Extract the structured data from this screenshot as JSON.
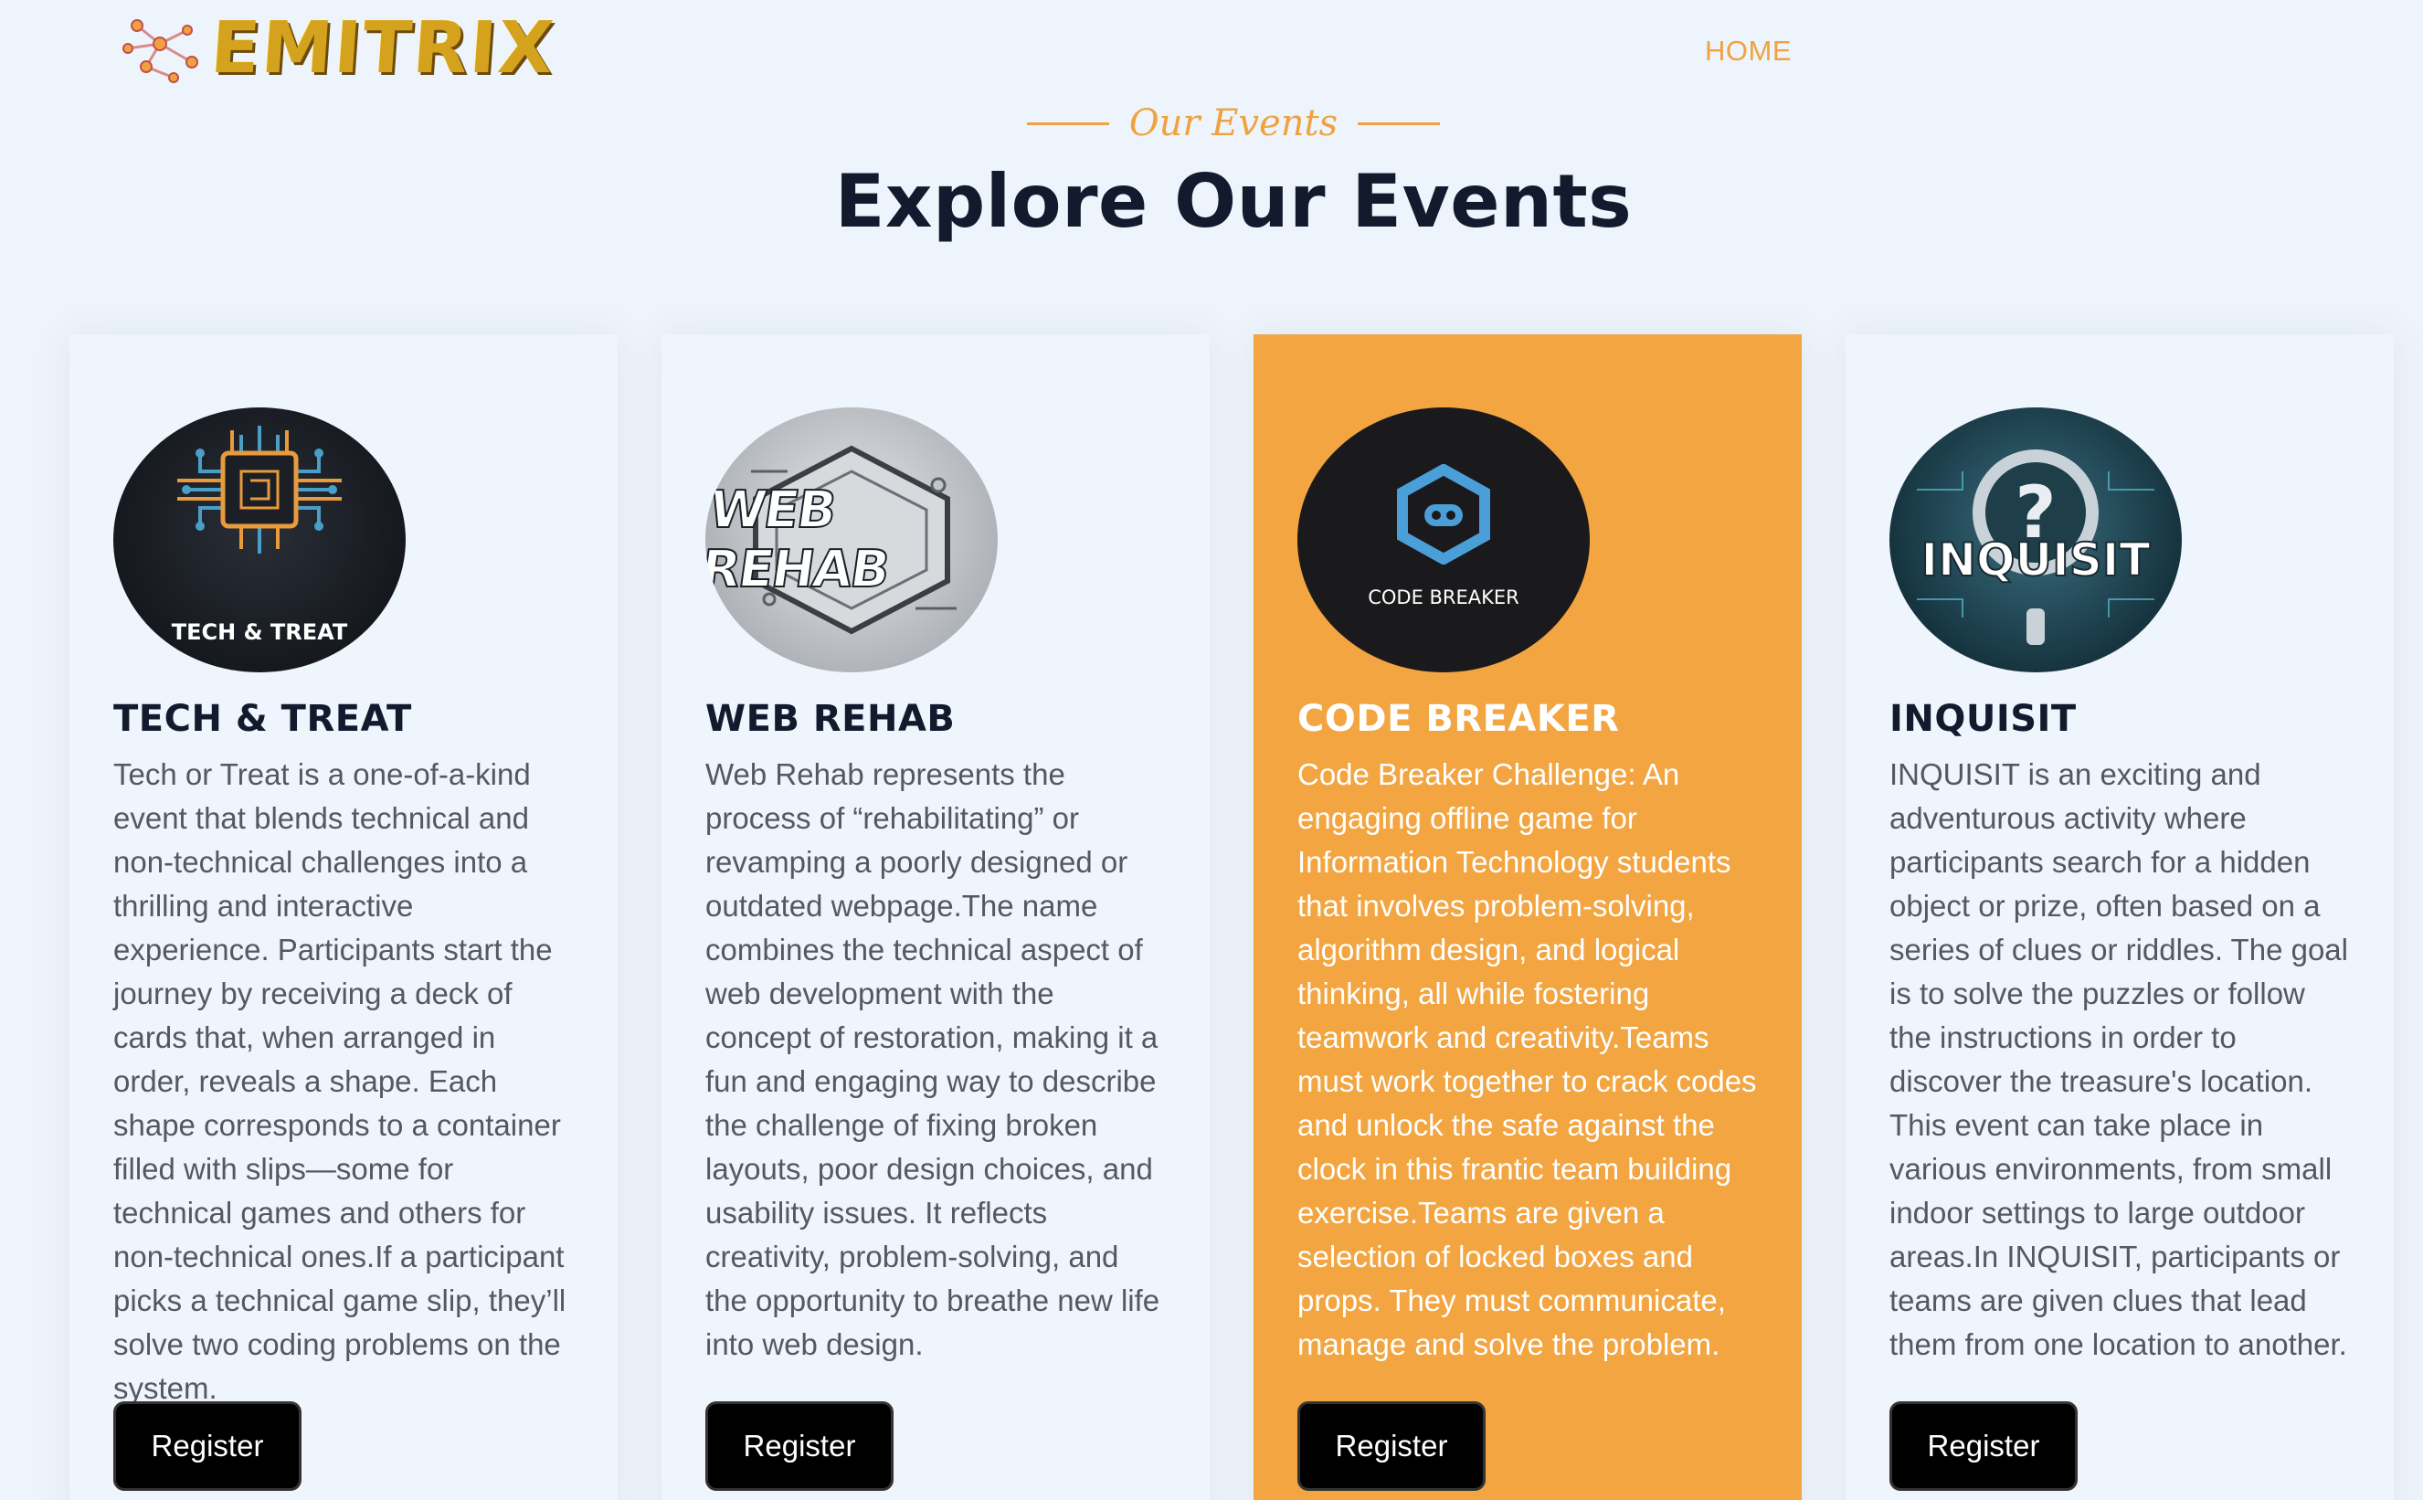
{
  "header": {
    "brand": "EMITRIX",
    "nav": {
      "home": "HOME"
    }
  },
  "section": {
    "eyebrow": "Our Events",
    "title": "Explore Our Events"
  },
  "colors": {
    "accent": "#f0a23f",
    "featured_card": "#f2a540",
    "heading": "#141a2d",
    "page_bg": "#eef4fb"
  },
  "events": [
    {
      "title": "TECH & TREAT",
      "image_text": "TECH & TREAT",
      "icon": "circuit-chip-icon",
      "description": "Tech or Treat is a one-of-a-kind event that blends technical and non-technical challenges into a thrilling and interactive experience. Participants start the journey by receiving a deck of cards that, when arranged in order, reveals a shape. Each shape corresponds to a container filled with slips—some for technical games and others for non-technical ones.If a participant picks a technical game slip, they’ll solve two coding problems on the system.",
      "register": "Register"
    },
    {
      "title": "WEB REHAB",
      "image_text": "WEB REHAB",
      "icon": "web-rehab-badge-icon",
      "description": "Web Rehab represents the process of “rehabilitating” or revamping a poorly designed or outdated webpage.The name combines the technical aspect of web development with the concept of restoration, making it a fun and engaging way to describe the challenge of fixing broken layouts, poor design choices, and usability issues. It reflects creativity, problem-solving, and the opportunity to breathe new life into web design.",
      "register": "Register"
    },
    {
      "title": "CODE BREAKER",
      "image_text": "CODE BREAKER",
      "icon": "hexagon-mask-icon",
      "description": "Code Breaker Challenge: An engaging offline game for Information Technology students that involves problem-solving, algorithm design, and logical thinking, all while fostering teamwork and creativity.Teams must work together to crack codes and unlock the safe against the clock in this frantic team building exercise.Teams are given a selection of locked boxes and props. They must communicate, manage and solve the problem.",
      "register": "Register"
    },
    {
      "title": "INQUISIT",
      "image_text": "INQUISIT",
      "icon": "question-magnifier-icon",
      "description": "INQUISIT is an exciting and adventurous activity where participants search for a hidden object or prize, often based on a series of clues or riddles. The goal is to solve the puzzles or follow the instructions in order to discover the treasure's location. This event can take place in various environments, from small indoor settings to large outdoor areas.In INQUISIT, participants or teams are given clues that lead them from one location to another.",
      "register": "Register"
    }
  ]
}
